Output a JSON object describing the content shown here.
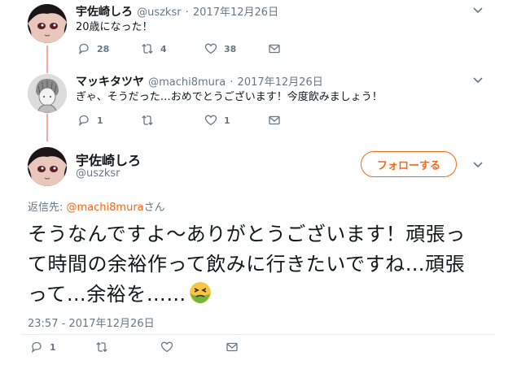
{
  "tweets": [
    {
      "name": "宇佐崎しろ",
      "handle": "@uszksr",
      "sep": "·",
      "date": "2017年12月26日",
      "text": "20歳になった！",
      "reply_count": "28",
      "retweet_count": "4",
      "like_count": "38"
    },
    {
      "name": "マッキタツヤ",
      "handle": "@machi8mura",
      "sep": "·",
      "date": "2017年12月26日",
      "text": "ぎゃ、そうだった…おめでとうございます！今度飲みましょう！",
      "reply_count": "1",
      "retweet_count": "",
      "like_count": "1"
    }
  ],
  "main": {
    "name": "宇佐崎しろ",
    "handle": "@uszksr",
    "follow_label": "フォローする",
    "reply_to_prefix": "返信先: ",
    "reply_to_handle": "@machi8mura",
    "reply_to_suffix": "さん",
    "text": "そうなんですよ〜ありがとうございます！頑張って時間の余裕作って飲みに行きたいですね…頑張って…余裕を……",
    "timestamp": "23:57 - 2017年12月26日",
    "reply_count": "1",
    "retweet_count": "",
    "like_count": ""
  },
  "colors": {
    "accent": "#f4671b",
    "thread_line": "#f5a9a0",
    "secondary_text": "#657786"
  },
  "icons": {
    "reply": "reply-icon",
    "retweet": "retweet-icon",
    "like": "heart-icon",
    "dm": "envelope-icon",
    "menu": "chevron-down-icon",
    "emoji": "nauseated-face-icon"
  }
}
